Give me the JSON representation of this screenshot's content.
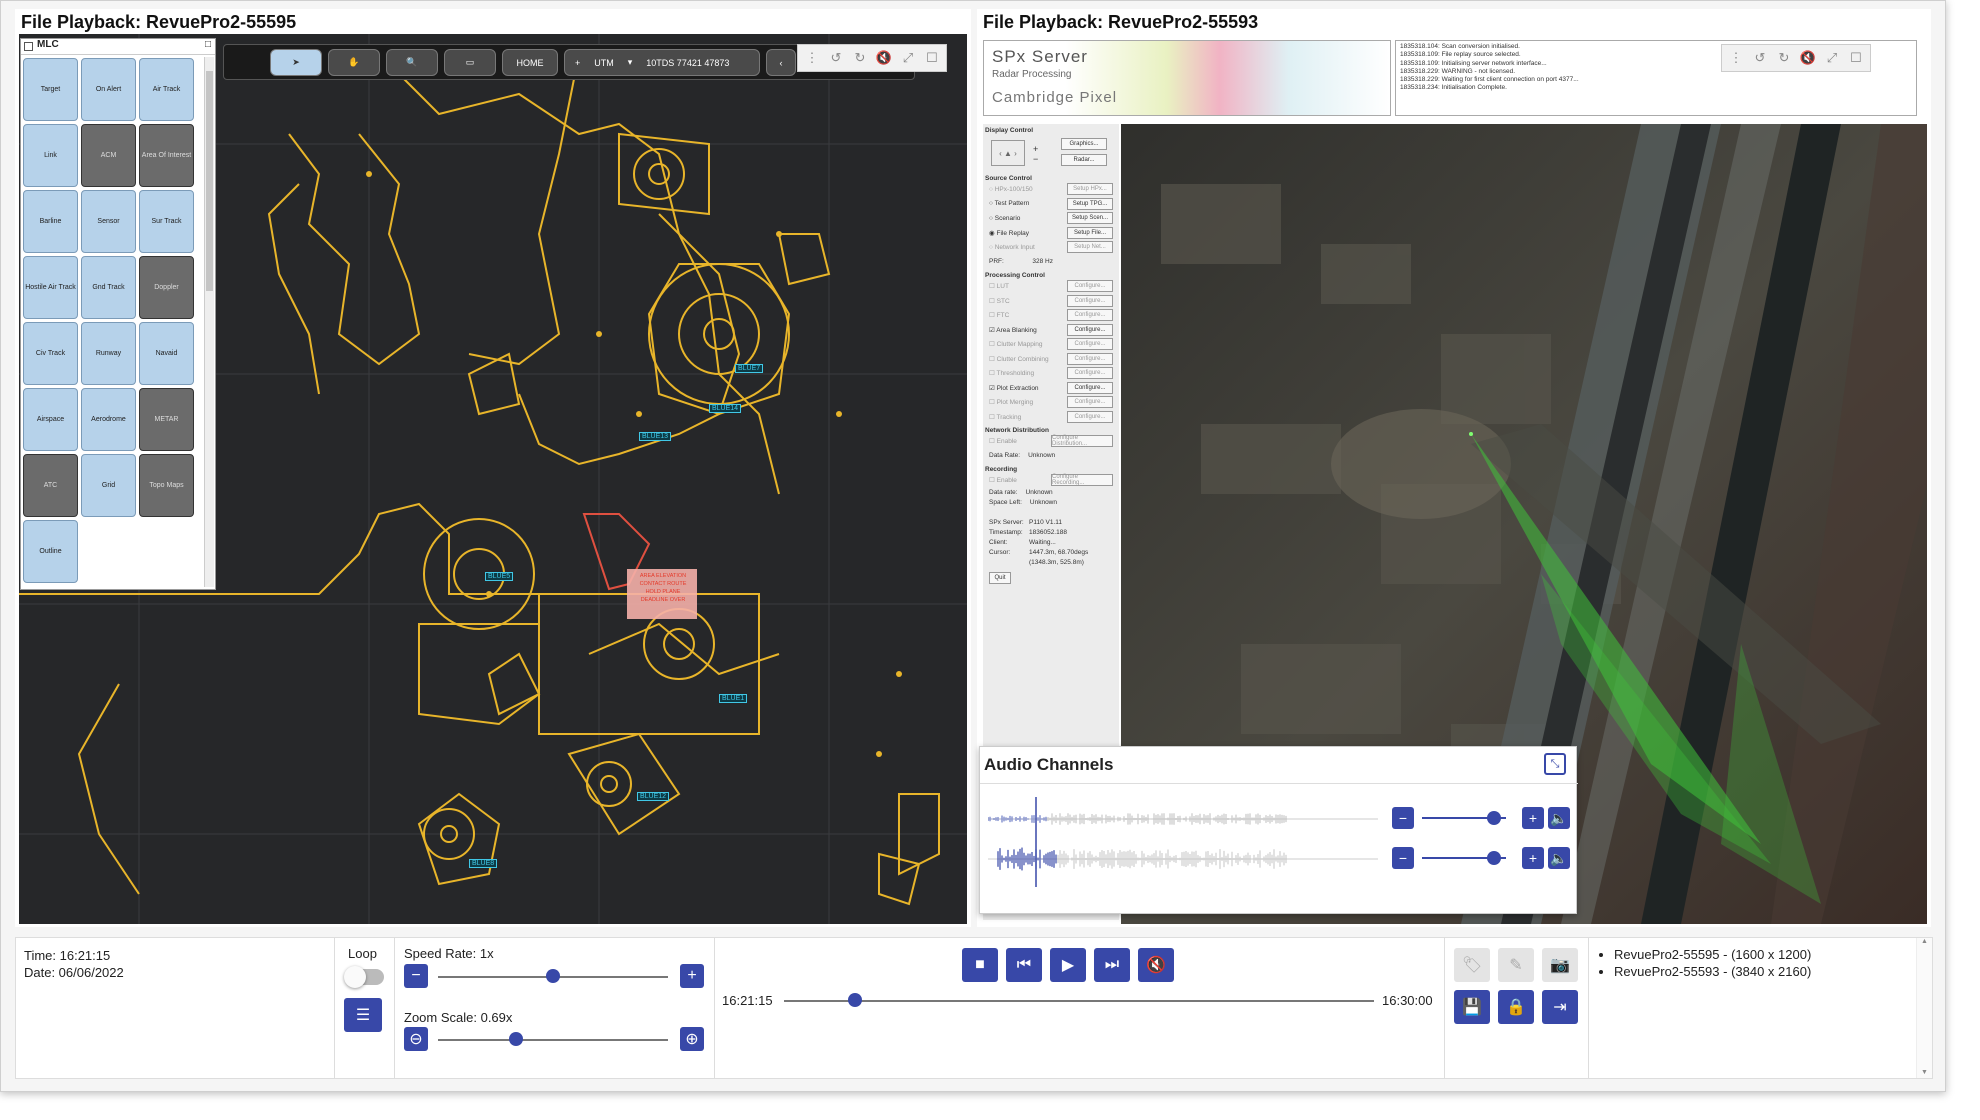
{
  "left_pane": {
    "title": "File Playback: RevuePro2-55595",
    "mlc": {
      "title": "MLC",
      "buttons": [
        {
          "label": "Target",
          "dark": false
        },
        {
          "label": "On Alert",
          "dark": false
        },
        {
          "label": "Air Track",
          "dark": false
        },
        {
          "label": "Link",
          "dark": false
        },
        {
          "label": "ACM",
          "dark": true
        },
        {
          "label": "Area Of Interest",
          "dark": true
        },
        {
          "label": "Barline",
          "dark": false
        },
        {
          "label": "Sensor",
          "dark": false
        },
        {
          "label": "Sur Track",
          "dark": false
        },
        {
          "label": "Hostile Air Track",
          "dark": false
        },
        {
          "label": "Gnd Track",
          "dark": false
        },
        {
          "label": "Doppler",
          "dark": true
        },
        {
          "label": "Civ Track",
          "dark": false
        },
        {
          "label": "Runway",
          "dark": false
        },
        {
          "label": "Navaid",
          "dark": false
        },
        {
          "label": "Airspace",
          "dark": false
        },
        {
          "label": "Aerodrome",
          "dark": false
        },
        {
          "label": "METAR",
          "dark": true
        },
        {
          "label": "ATC",
          "dark": true
        },
        {
          "label": "Grid",
          "dark": false
        },
        {
          "label": "Topo Maps",
          "dark": true
        },
        {
          "label": "Outline",
          "dark": false
        }
      ]
    },
    "toolbar": {
      "home": "HOME",
      "utm_label": "UTM",
      "coords": "10TDS 77421 47873"
    },
    "map_labels": [
      "BLUE7",
      "BLUE14",
      "BLUE13",
      "BLUE5",
      "BLUE1",
      "BLUE12",
      "BLUE8",
      "BLUE13"
    ],
    "warning_text": "AREA ELEVATION\nCONTACT ROUTE\nHOLD PLANE\nDEADLINE OVER"
  },
  "right_pane": {
    "title": "File Playback: RevuePro2-55593",
    "spx": {
      "name": "SPx Server",
      "sub": "Radar Processing",
      "company": "Cambridge Pixel",
      "log": [
        "1835318.104: Scan conversion initialised.",
        "1835318.109: File replay source selected.",
        "1835318.109: Initialising server network interface...",
        "1835318.229: WARNING - not licensed.",
        "1835318.229: Waiting for first client connection on port 4377...",
        "1835318.234: Initialisation Complete."
      ],
      "sections": {
        "display": "Display Control",
        "source": "Source Control",
        "processing": "Processing Control",
        "network": "Network Distribution",
        "recording": "Recording"
      },
      "display_buttons": [
        "Graphics...",
        "Radar..."
      ],
      "source_rows": [
        {
          "label": "HPx-100/150",
          "btn": "Setup HPx...",
          "dim": true
        },
        {
          "label": "Test Pattern",
          "btn": "Setup TPG...",
          "dim": false
        },
        {
          "label": "Scenario",
          "btn": "Setup Scen...",
          "dim": false
        },
        {
          "label": "File Replay",
          "btn": "Setup File...",
          "dim": false
        },
        {
          "label": "Network Input",
          "btn": "Setup Net...",
          "dim": true
        }
      ],
      "prf": "PRF:",
      "prf_value": "328 Hz",
      "proc_rows": [
        {
          "label": "LUT",
          "dim": true
        },
        {
          "label": "STC",
          "dim": true
        },
        {
          "label": "FTC",
          "dim": true
        },
        {
          "label": "Area Blanking",
          "dim": false
        },
        {
          "label": "Clutter Mapping",
          "dim": true
        },
        {
          "label": "Clutter Combining",
          "dim": true
        },
        {
          "label": "Thresholding",
          "dim": true
        },
        {
          "label": "Plot Extraction",
          "dim": false
        },
        {
          "label": "Plot Merging",
          "dim": true
        },
        {
          "label": "Tracking",
          "dim": true
        }
      ],
      "configure": "Configure...",
      "enable": "Enable",
      "configure_distribution": "Configure Distribution...",
      "configure_recording": "Configure Recording...",
      "data_rate_label": "Data Rate:",
      "data_rate": "Unknown",
      "rec_data_rate_label": "Data rate:",
      "rec_data_rate": "Unknown",
      "space_left_label": "Space Left:",
      "space_left": "Unknown",
      "info": [
        {
          "k": "SPx Server:",
          "v": "P110 V1.11"
        },
        {
          "k": "Timestamp:",
          "v": "1836052.188"
        },
        {
          "k": "Client:",
          "v": "Waiting..."
        },
        {
          "k": "Cursor:",
          "v": "1447.3m, 68.70degs"
        },
        {
          "k": "",
          "v": "(1348.3m, 525.8m)"
        }
      ],
      "quit": "Quit"
    }
  },
  "audio": {
    "title": "Audio Channels",
    "channels": [
      {
        "level": 0.86
      },
      {
        "level": 0.86
      }
    ]
  },
  "bottom": {
    "time": "Time: 16:21:15",
    "date": "Date: 06/06/2022",
    "loop": "Loop",
    "speed": "Speed Rate: 1x",
    "speed_level": 0.5,
    "zoom": "Zoom Scale: 0.69x",
    "zoom_level": 0.34,
    "start_time": "16:21:15",
    "end_time": "16:30:00",
    "progress": 0.12,
    "files": [
      "RevuePro2-55595 - (1600 x 1200)",
      "RevuePro2-55593 - (3840 x 2160)"
    ]
  },
  "colors": {
    "accent": "#3848a8",
    "map_yellow": "#e8b52a",
    "map_bg": "#262729",
    "radar_green": "#3fc23a",
    "label_cyan": "#41c8e6"
  },
  "icons": [
    "pointer-icon",
    "hand-icon",
    "zoom-icon",
    "ruler-icon",
    "stop-icon",
    "skip-back-icon",
    "play-icon",
    "skip-forward-icon",
    "mute-icon",
    "tag-icon",
    "pencil-icon",
    "camera-icon",
    "save-icon",
    "lock-icon",
    "exit-icon",
    "menu-icon",
    "rotate-left-icon",
    "rotate-right-icon",
    "fullscreen-icon",
    "restore-icon",
    "close-icon",
    "settings-sliders-icon"
  ]
}
